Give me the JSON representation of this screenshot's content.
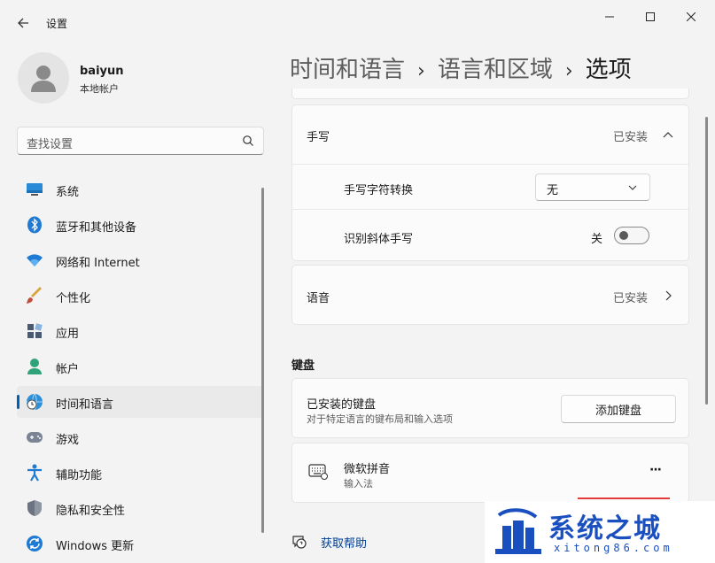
{
  "window": {
    "title": "设置"
  },
  "user": {
    "name": "baiyun",
    "account_type": "本地帐户"
  },
  "search": {
    "placeholder": "查找设置"
  },
  "nav": {
    "items": [
      {
        "label": "系统",
        "icon": "monitor-icon"
      },
      {
        "label": "蓝牙和其他设备",
        "icon": "bluetooth-icon"
      },
      {
        "label": "网络和 Internet",
        "icon": "wifi-icon"
      },
      {
        "label": "个性化",
        "icon": "brush-icon"
      },
      {
        "label": "应用",
        "icon": "apps-icon"
      },
      {
        "label": "帐户",
        "icon": "person-icon"
      },
      {
        "label": "时间和语言",
        "icon": "globe-clock-icon",
        "active": true
      },
      {
        "label": "游戏",
        "icon": "gamepad-icon"
      },
      {
        "label": "辅助功能",
        "icon": "accessibility-icon"
      },
      {
        "label": "隐私和安全性",
        "icon": "shield-icon"
      },
      {
        "label": "Windows 更新",
        "icon": "update-icon"
      }
    ]
  },
  "breadcrumb": {
    "level1": "时间和语言",
    "level2": "语言和区域",
    "current": "选项",
    "separator": "›"
  },
  "handwriting": {
    "title": "手写",
    "status": "已安装",
    "char_convert_label": "手写字符转换",
    "char_convert_value": "无",
    "italic_label": "识别斜体手写",
    "italic_state": "关"
  },
  "speech": {
    "title": "语音",
    "status": "已安装"
  },
  "keyboard": {
    "section_title": "键盘",
    "installed_title": "已安装的键盘",
    "installed_desc": "对于特定语言的键布局和输入选项",
    "add_button": "添加键盘",
    "ime_name": "微软拼音",
    "ime_type": "输入法",
    "more": "···"
  },
  "help": {
    "label": "获取帮助"
  },
  "watermark": {
    "title": "系统之城",
    "url": "xitong86.com"
  },
  "colors": {
    "accent": "#005fb8",
    "watermark": "#1a4fbf"
  }
}
